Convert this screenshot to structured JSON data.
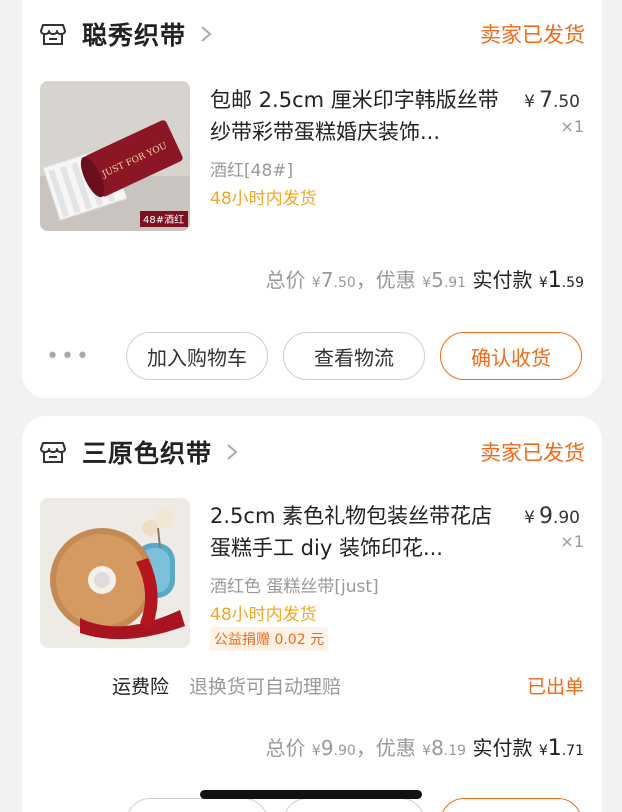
{
  "orders": [
    {
      "shop_name": "聪秀织带",
      "status": "卖家已发货",
      "product_title": "包邮 2.5cm 厘米印字韩版丝带纱带彩带蛋糕婚庆装饰...",
      "price_yen": "¥",
      "price_int": "7",
      "price_dec": ".50",
      "quantity": "×1",
      "spec": "酒红[48#]",
      "ship_promise": "48小时内发货",
      "thumb_label": "48#酒红",
      "ribbon_text": "JUST FOR YOU",
      "summary": {
        "total_label": "总价",
        "total_int": "7",
        "total_dec": ".50",
        "discount_label": "，优惠",
        "discount_int": "5",
        "discount_dec": ".91",
        "paid_label": "实付款",
        "paid_int": "1",
        "paid_dec": ".59",
        "yen": "¥"
      },
      "buttons": {
        "more": "•••",
        "add_cart": "加入购物车",
        "view_logistics": "查看物流",
        "confirm_receipt": "确认收货"
      }
    },
    {
      "shop_name": "三原色织带",
      "status": "卖家已发货",
      "product_title": "2.5cm 素色礼物包装丝带花店蛋糕手工 diy 装饰印花...",
      "price_yen": "¥",
      "price_int": "9",
      "price_dec": ".90",
      "quantity": "×1",
      "spec": "酒红色  蛋糕丝带[just]",
      "ship_promise": "48小时内发货",
      "charity": "公益捐赠 0.02 元",
      "insurance": {
        "label": "运费险",
        "desc": "退换货可自动理赔",
        "status": "已出单"
      },
      "summary": {
        "total_label": "总价",
        "total_int": "9",
        "total_dec": ".90",
        "discount_label": "，优惠",
        "discount_int": "8",
        "discount_dec": ".19",
        "paid_label": "实付款",
        "paid_int": "1",
        "paid_dec": ".71",
        "yen": "¥"
      }
    }
  ],
  "colors": {
    "accent": "#f06a1a",
    "ship": "#f5a623",
    "muted": "#999999",
    "background": "#f2f2f2"
  }
}
